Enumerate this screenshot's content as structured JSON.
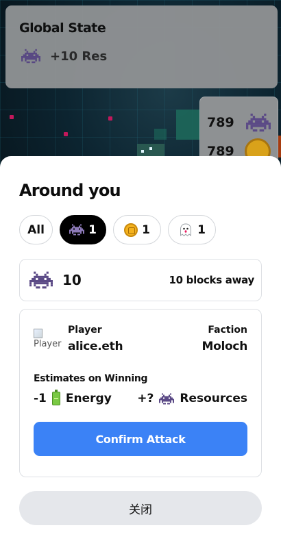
{
  "global_state": {
    "title": "Global State",
    "resources_delta": "+10 Res"
  },
  "side_panel": {
    "row1_value": "789",
    "row2_value": "789"
  },
  "sheet": {
    "title": "Around you",
    "filters": [
      {
        "label": "All",
        "active": false
      },
      {
        "count": "1",
        "icon": "invader-icon",
        "active": true
      },
      {
        "count": "1",
        "icon": "coin-icon",
        "active": false
      },
      {
        "count": "1",
        "icon": "ghost-icon",
        "active": false
      }
    ],
    "target": {
      "value": "10",
      "distance": "10 blocks away"
    },
    "attack": {
      "player_img_alt": "Player",
      "player_label": "Player",
      "player_name": "alice.eth",
      "faction_label": "Faction",
      "faction_name": "Moloch",
      "estimates_label": "Estimates on Winning",
      "energy_delta": "-1",
      "energy_label": "Energy",
      "resources_delta": "+?",
      "resources_label": "Resources",
      "confirm_label": "Confirm Attack"
    },
    "close_label": "关闭"
  },
  "colors": {
    "accent": "#3b82f6",
    "invader": "#6b5b95",
    "active_chip": "#000000"
  }
}
